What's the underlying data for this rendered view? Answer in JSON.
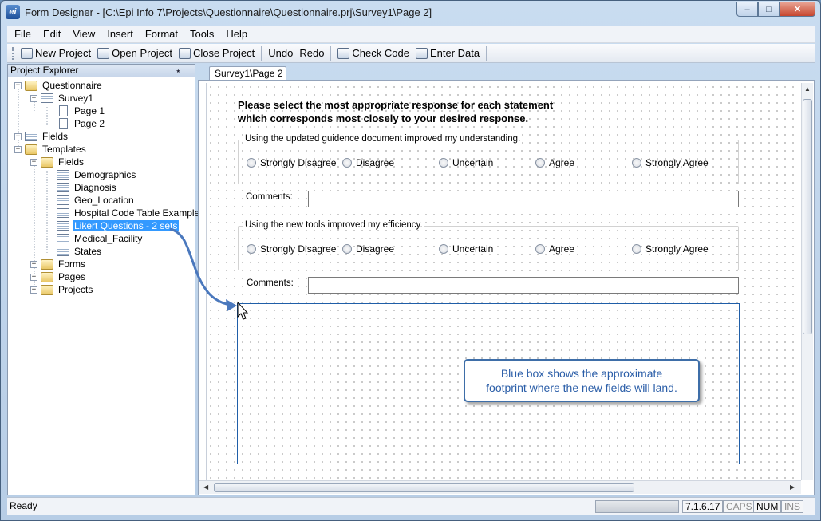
{
  "window": {
    "title": "Form Designer - [C:\\Epi Info 7\\Projects\\Questionnaire\\Questionnaire.prj\\Survey1\\Page 2]",
    "app_icon": "ei",
    "minimize": "–",
    "maximize": "□",
    "close": "✕"
  },
  "menu": [
    "File",
    "Edit",
    "View",
    "Insert",
    "Format",
    "Tools",
    "Help"
  ],
  "toolbar": {
    "new_project": "New Project",
    "open_project": "Open Project",
    "close_project": "Close Project",
    "undo": "Undo",
    "redo": "Redo",
    "check_code": "Check Code",
    "enter_data": "Enter Data"
  },
  "explorer": {
    "title": "Project Explorer",
    "pin": "⭑",
    "nodes": [
      {
        "label": "Questionnaire",
        "expander": "−",
        "icon": "folder-icon"
      },
      {
        "label": "Survey1",
        "expander": "−",
        "icon": "form-icon"
      },
      {
        "label": "Page 1",
        "expander": "",
        "icon": "page-icon"
      },
      {
        "label": "Page 2",
        "expander": "",
        "icon": "page-icon"
      },
      {
        "label": "Fields",
        "expander": "+",
        "icon": "form-icon"
      },
      {
        "label": "Templates",
        "expander": "−",
        "icon": "folder-icon"
      },
      {
        "label": "Fields",
        "expander": "−",
        "icon": "folder-icon"
      },
      {
        "label": "Demographics",
        "expander": "",
        "icon": "form-icon"
      },
      {
        "label": "Diagnosis",
        "expander": "",
        "icon": "form-icon"
      },
      {
        "label": "Geo_Location",
        "expander": "",
        "icon": "form-icon"
      },
      {
        "label": "Hospital Code Table Example",
        "expander": "",
        "icon": "form-icon"
      },
      {
        "label": "Likert Questions - 2 sets",
        "expander": "",
        "icon": "form-icon",
        "selected": true
      },
      {
        "label": "Medical_Facility",
        "expander": "",
        "icon": "form-icon"
      },
      {
        "label": "States",
        "expander": "",
        "icon": "form-icon"
      },
      {
        "label": "Forms",
        "expander": "+",
        "icon": "folder-icon"
      },
      {
        "label": "Pages",
        "expander": "+",
        "icon": "folder-icon"
      },
      {
        "label": "Projects",
        "expander": "+",
        "icon": "folder-icon"
      }
    ]
  },
  "tab": {
    "label": "Survey1\\Page 2"
  },
  "form": {
    "heading_line1": "Please select the most appropriate response for each statement",
    "heading_line2": "which corresponds most closely to your desired response.",
    "question1": "Using the updated guidence document improved my understanding.",
    "question2": "Using the new tools improved my efficiency.",
    "options": [
      "Strongly Disagree",
      "Disagree",
      "Uncertain",
      "Agree",
      "Strongly Agree"
    ],
    "comments_label": "Comments:",
    "callout_line1": "Blue box shows the approximate",
    "callout_line2": "footprint where the new fields will land."
  },
  "status": {
    "text": "Ready",
    "version": "7.1.6.17",
    "caps": "CAPS",
    "num": "NUM",
    "ins": "INS"
  },
  "colors": {
    "selection": "#3399ff",
    "drop_zone_border": "#1f5ea8",
    "callout_text": "#2b5ea8",
    "arrow": "#4a78bd"
  }
}
